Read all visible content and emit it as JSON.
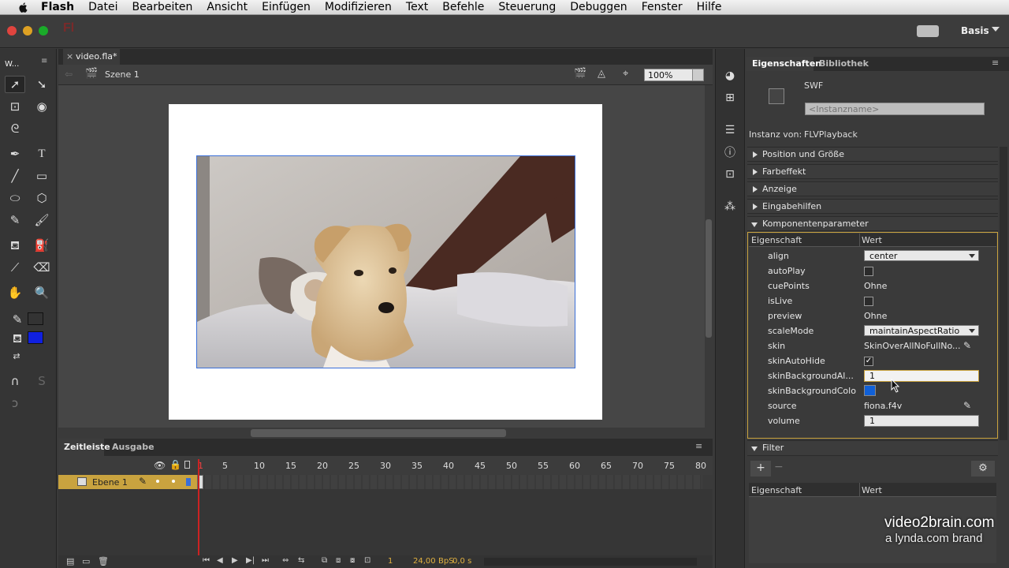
{
  "menubar": {
    "app_name": "Flash",
    "items": [
      "Datei",
      "Bearbeiten",
      "Ansicht",
      "Einfügen",
      "Modifizieren",
      "Text",
      "Befehle",
      "Steuerung",
      "Debuggen",
      "Fenster",
      "Hilfe"
    ]
  },
  "titlebar": {
    "app_logo": "Fl",
    "workspace": "Basis"
  },
  "tools_panel": {
    "title": "W..."
  },
  "document": {
    "tab_label": "video.fla*",
    "scene_label": "Szene 1",
    "zoom": "100%"
  },
  "timeline": {
    "tabs": [
      "Zeitleiste",
      "Ausgabe"
    ],
    "layer_name": "Ebene 1",
    "frame_ticks": [
      "1",
      "5",
      "10",
      "15",
      "20",
      "25",
      "30",
      "35",
      "40",
      "45",
      "50",
      "55",
      "60",
      "65",
      "70",
      "75",
      "80"
    ],
    "current_frame": "1",
    "fps": "24,00",
    "fps_unit": "BpS",
    "time": "0,0 s"
  },
  "properties": {
    "tabs": [
      "Eigenschaften",
      "Bibliothek"
    ],
    "symbol_type": "SWF",
    "instance_name_placeholder": "<Instanzname>",
    "instance_of_label": "Instanz von:",
    "instance_of_value": "FLVPlayback",
    "sections": [
      "Position und Größe",
      "Farbeffekt",
      "Anzeige",
      "Eingabehilfen"
    ],
    "component_section": "Komponentenparameter",
    "col_property": "Eigenschaft",
    "col_value": "Wert",
    "params": [
      {
        "name": "align",
        "value": "center",
        "kind": "dropdown"
      },
      {
        "name": "autoPlay",
        "value": "",
        "kind": "checkbox",
        "checked": false
      },
      {
        "name": "cuePoints",
        "value": "Ohne",
        "kind": "text"
      },
      {
        "name": "isLive",
        "value": "",
        "kind": "checkbox",
        "checked": false
      },
      {
        "name": "preview",
        "value": "Ohne",
        "kind": "text"
      },
      {
        "name": "scaleMode",
        "value": "maintainAspectRatio",
        "kind": "dropdown"
      },
      {
        "name": "skin",
        "value": "SkinOverAllNoFullNo...",
        "kind": "edit"
      },
      {
        "name": "skinAutoHide",
        "value": "",
        "kind": "checkbox",
        "checked": true
      },
      {
        "name": "skinBackgroundAl...",
        "value": "1",
        "kind": "field_active"
      },
      {
        "name": "skinBackgroundColor",
        "value": "",
        "kind": "color",
        "color": "#1060d8"
      },
      {
        "name": "source",
        "value": "fiona.f4v",
        "kind": "edit"
      },
      {
        "name": "volume",
        "value": "1",
        "kind": "field"
      }
    ],
    "filter_section": "Filter",
    "filter_col_property": "Eigenschaft",
    "filter_col_value": "Wert"
  },
  "watermark": {
    "line1": "video2brain.com",
    "line2": "a lynda.com brand"
  },
  "colors": {
    "stroke_swatch": "#333333",
    "fill_swatch": "#1020e0",
    "accent_gold": "#c9a33f",
    "skin_bg_color": "#1060d8"
  },
  "icons": [
    "apple-icon",
    "selection-tool-icon",
    "subselection-tool-icon",
    "free-transform-icon",
    "3d-rotation-icon",
    "lasso-icon",
    "pen-tool-icon",
    "text-tool-icon",
    "line-tool-icon",
    "rectangle-tool-icon",
    "oval-tool-icon",
    "polystar-tool-icon",
    "pencil-tool-icon",
    "brush-tool-icon",
    "paint-bucket-icon",
    "ink-bottle-icon",
    "eyedropper-icon",
    "eraser-icon",
    "hand-tool-icon",
    "zoom-tool-icon",
    "snap-magnet-icon",
    "eye-icon",
    "lock-icon",
    "outline-icon",
    "play-icon",
    "gear-icon",
    "add-filter-icon",
    "pencil-edit-icon"
  ]
}
